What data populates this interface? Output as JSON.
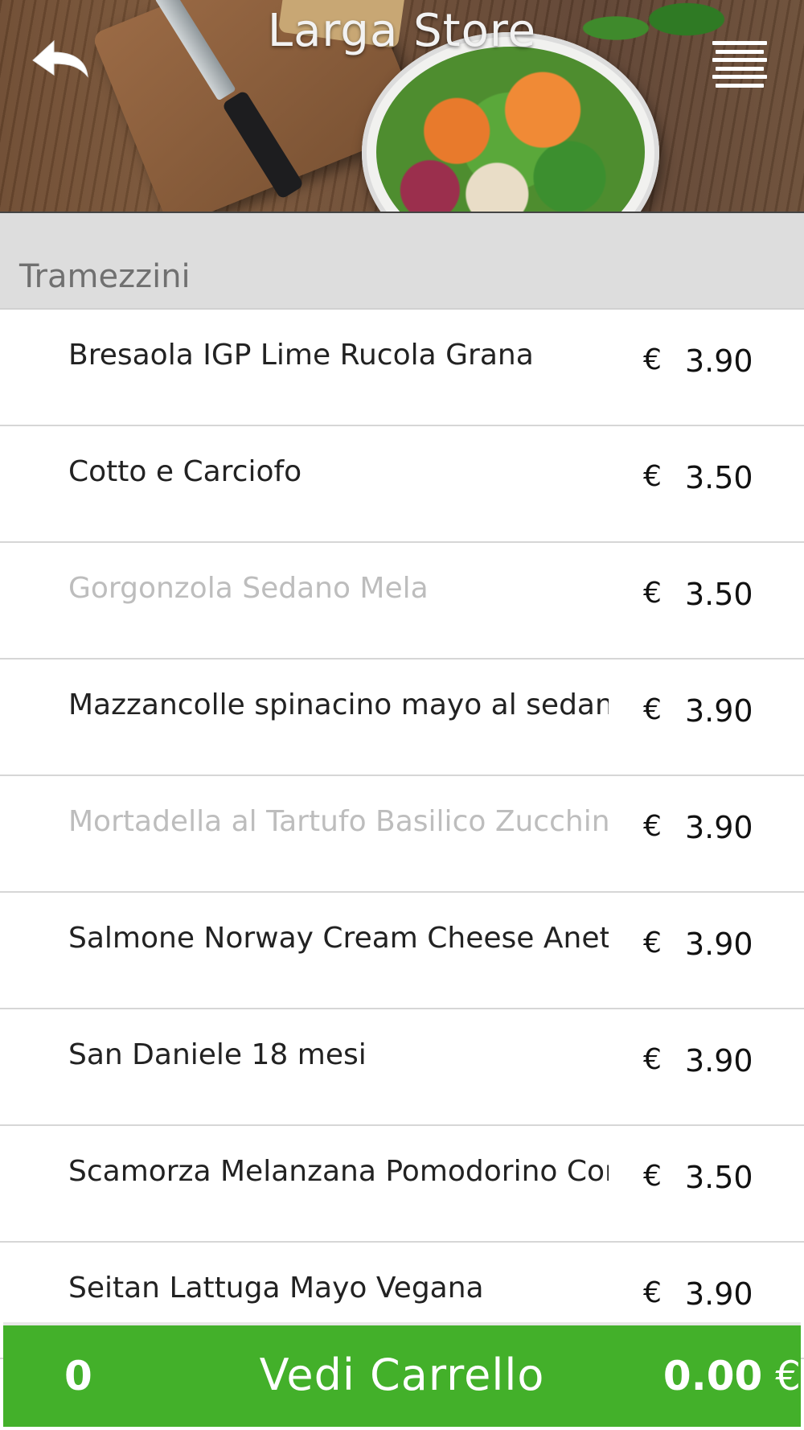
{
  "header": {
    "title": "Larga Store",
    "back_icon": "back-arrow-icon",
    "menu_icon": "hamburger-menu-icon"
  },
  "section": {
    "title": "Tramezzini"
  },
  "items": [
    {
      "name": "Bresaola IGP Lime Rucola Grana",
      "currency": "€",
      "price": "3.90",
      "available": true
    },
    {
      "name": "Cotto e Carciofo",
      "currency": "€",
      "price": "3.50",
      "available": true
    },
    {
      "name": "Gorgonzola Sedano Mela",
      "currency": "€",
      "price": "3.50",
      "available": false
    },
    {
      "name": "Mazzancolle spinacino mayo al sedano",
      "currency": "€",
      "price": "3.90",
      "available": true
    },
    {
      "name": "Mortadella al Tartufo Basilico Zucchine",
      "currency": "€",
      "price": "3.90",
      "available": false
    },
    {
      "name": "Salmone Norway Cream Cheese Aneto",
      "currency": "€",
      "price": "3.90",
      "available": true
    },
    {
      "name": "San Daniele 18 mesi",
      "currency": "€",
      "price": "3.90",
      "available": true
    },
    {
      "name": "Scamorza Melanzana Pomodorino Confit",
      "currency": "€",
      "price": "3.50",
      "available": true
    },
    {
      "name": "Seitan Lattuga Mayo Vegana",
      "currency": "€",
      "price": "3.90",
      "available": true
    }
  ],
  "cart": {
    "count": "0",
    "label": "Vedi Carrello",
    "total": "0.00",
    "currency": "€",
    "color": "#43b02a"
  },
  "colors": {
    "section_bg": "#dddddd",
    "disabled_text": "#bdbdbd"
  }
}
